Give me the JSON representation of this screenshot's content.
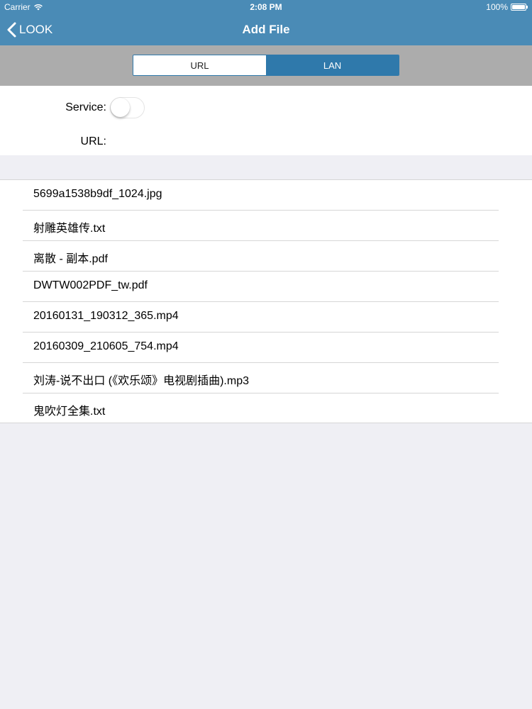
{
  "status_bar": {
    "carrier": "Carrier",
    "time": "2:08 PM",
    "battery": "100%",
    "wifi_icon": "wifi-icon",
    "battery_icon": "battery-icon"
  },
  "nav": {
    "back_label": "LOOK",
    "back_icon": "chevron-left-icon",
    "title": "Add File"
  },
  "segments": {
    "items": [
      {
        "label": "URL",
        "selected": false
      },
      {
        "label": "LAN",
        "selected": true
      }
    ]
  },
  "form": {
    "service_label": "Service:",
    "service_enabled": false,
    "url_label": "URL:"
  },
  "files": [
    "5699a1538b9df_1024.jpg",
    "射雕英雄传.txt",
    "离散 - 副本.pdf",
    "DWTW002PDF_tw.pdf",
    "20160131_190312_365.mp4",
    "20160309_210605_754.mp4",
    "刘涛-说不出口 (《欢乐颂》电视剧插曲).mp3",
    "鬼吹灯全集.txt"
  ],
  "colors": {
    "nav_background": "#4a8bb6",
    "segment_accent": "#2f79ab",
    "segment_bar_background": "#acacac",
    "page_background": "#efeff4"
  }
}
